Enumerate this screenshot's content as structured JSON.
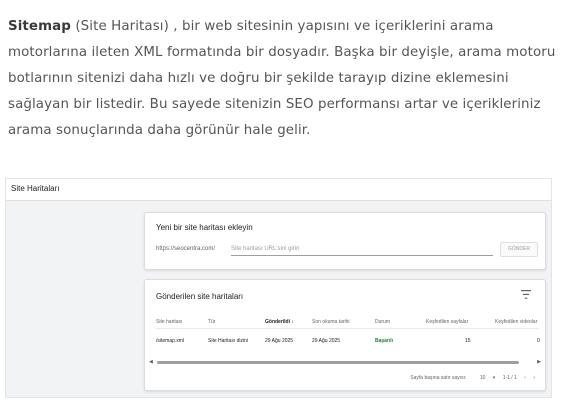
{
  "article": {
    "term": "Sitemap",
    "text": " (Site Haritası) , bir web sitesinin yapısını ve içeriklerini arama motorlarına ileten XML formatında bir dosyadır. Başka bir deyişle, arama motoru botlarının sitenizi daha hızlı ve doğru bir şekilde tarayıp dizine eklemesini sağlayan bir listedir. Bu sayede sitenizin SEO performansı artar ve içerikleriniz arama sonuçlarında daha görünür hale gelir."
  },
  "screenshot": {
    "header_title": "Site Haritaları",
    "add_card": {
      "title": "Yeni bir site haritası ekleyin",
      "url_prefix": "https://seocentra.com/",
      "input_placeholder": "Site haritası URL'sini girin",
      "submit_label": "GÖNDER"
    },
    "list_card": {
      "title": "Gönderilen site haritaları",
      "columns": [
        "Site haritası",
        "Tür",
        "Gönderildi",
        "Son okuma tarihi",
        "Durum",
        "Keşfedilen sayfalar",
        "Keşfedilen videolar"
      ],
      "rows": [
        {
          "sitemap": "/sitemap.xml",
          "type": "Site Haritası dizini",
          "submitted": "29 Ağu 2025",
          "last_read": "29 Ağu 2025",
          "status": "Başarılı",
          "pages": "15",
          "videos": "0"
        }
      ],
      "pager": {
        "rows_per_page_label": "Sayfa başına satır sayısı:",
        "rows_per_page_value": "10",
        "range": "1-1 / 1"
      }
    },
    "colors": {
      "success": "#188038",
      "card_border": "#dadce0",
      "background": "#f1f3f4"
    }
  }
}
